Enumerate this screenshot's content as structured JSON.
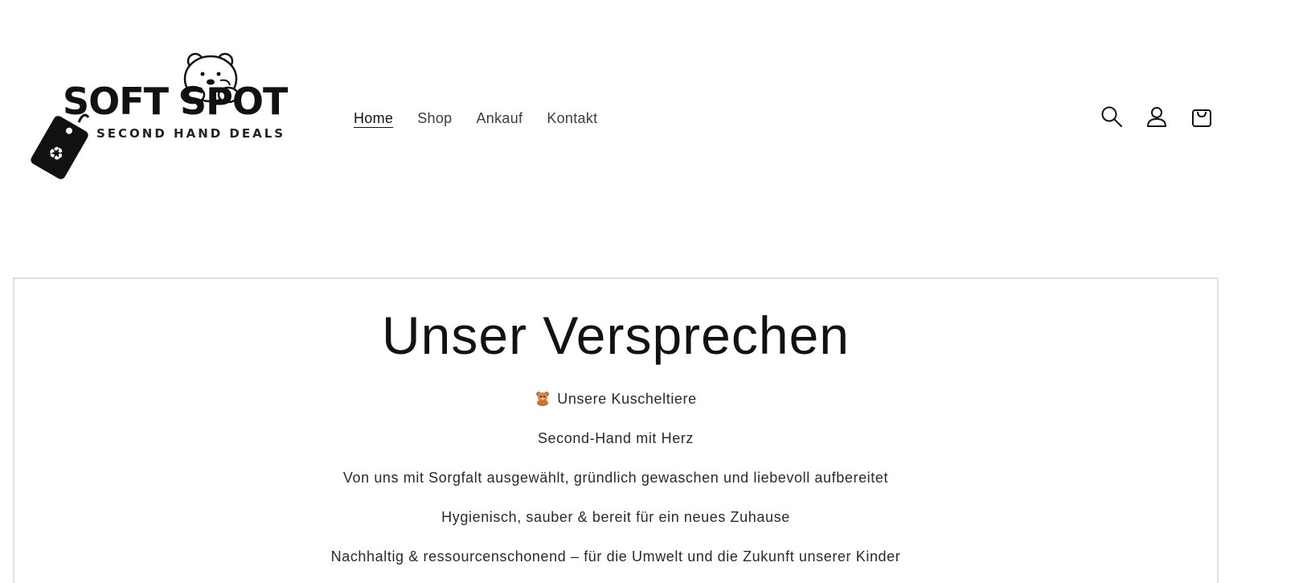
{
  "logo": {
    "brand": "SOFT SPOT",
    "tagline": "SECOND HAND DEALS"
  },
  "nav": {
    "items": [
      {
        "label": "Home",
        "active": true
      },
      {
        "label": "Shop",
        "active": false
      },
      {
        "label": "Ankauf",
        "active": false
      },
      {
        "label": "Kontakt",
        "active": false
      }
    ]
  },
  "header_icons": [
    "search-icon",
    "account-icon",
    "cart-icon"
  ],
  "promise": {
    "title": "Unser Versprechen",
    "lines": [
      "Unsere Kuscheltiere",
      "Second-Hand mit Herz",
      "Von uns mit Sorgfalt ausgewählt, gründlich gewaschen und liebevoll aufbereitet",
      "Hygienisch, sauber & bereit für ein neues Zuhause",
      "Nachhaltig & ressourcenschonend – für die Umwelt und die Zukunft unserer Kinder"
    ]
  },
  "colors": {
    "text": "#121212",
    "border": "#e0e0e0",
    "background": "#ffffff"
  }
}
